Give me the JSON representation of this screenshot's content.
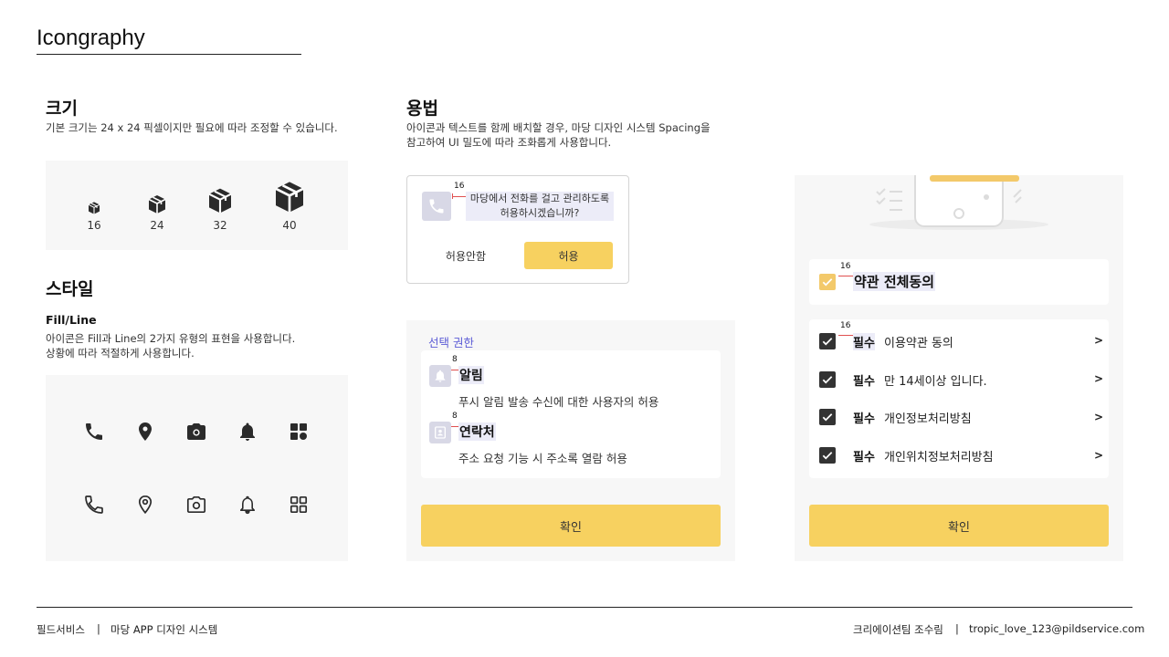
{
  "page": {
    "title": "Icongraphy"
  },
  "size_section": {
    "title": "크기",
    "description": "기본 크기는 24 x 24 픽셀이지만 필요에 따라 조정할 수 있습니다.",
    "sizes": [
      "16",
      "24",
      "32",
      "40"
    ]
  },
  "style_section": {
    "title": "스타일",
    "subtitle": "Fill/Line",
    "description_line1": "아이콘은 Fill과 Line의 2가지 유형의 표현을 사용합니다.",
    "description_line2": "상황에 따라 적절하게 사용합니다.",
    "icons": [
      "phone-icon",
      "location-pin-icon",
      "camera-icon",
      "bell-icon",
      "grid-icon"
    ]
  },
  "usage_section": {
    "title": "용법",
    "description_line1": "아이콘과 텍스트를 함께 배치할 경우, 마당 디자인 시스템 Spacing을",
    "description_line2": "참고하여 UI 밀도에 따라 조화롭게 사용합니다."
  },
  "dialog": {
    "spacing": "16",
    "message_line1": "마당에서 전화를 걸고 관리하도록",
    "message_line2": "허용하시겠습니까?",
    "deny_label": "허용안함",
    "allow_label": "허용"
  },
  "permission": {
    "header": "선택 권한",
    "spacing": "8",
    "items": [
      {
        "title": "알림",
        "desc": "푸시 알림 발송 수신에 대한 사용자의 허용"
      },
      {
        "title": "연락처",
        "desc": "주소 요청 기능 시 주소록 열람 허용"
      }
    ],
    "confirm_label": "확인"
  },
  "agreement": {
    "spacing": "16",
    "all_label": "약관 전체동의",
    "required_label": "필수",
    "items": [
      {
        "text": "이용약관 동의",
        "arrow": ">"
      },
      {
        "text": "만 14세이상 입니다.",
        "arrow": ">"
      },
      {
        "text": "개인정보처리방침",
        "arrow": ">"
      },
      {
        "text": "개인위치정보처리방침",
        "arrow": ">"
      }
    ],
    "confirm_label": "확인"
  },
  "footer": {
    "left_company": "필드서비스",
    "separator": "|",
    "left_product": "마당 APP 디자인 시스템",
    "right_team": "크리에이션팀 조수림",
    "right_email": "tropic_love_123@pildservice.com"
  },
  "colors": {
    "accent": "#f7d160",
    "highlight": "#ececf8",
    "link": "#5b5bd6",
    "panel": "#f7f7f7"
  }
}
